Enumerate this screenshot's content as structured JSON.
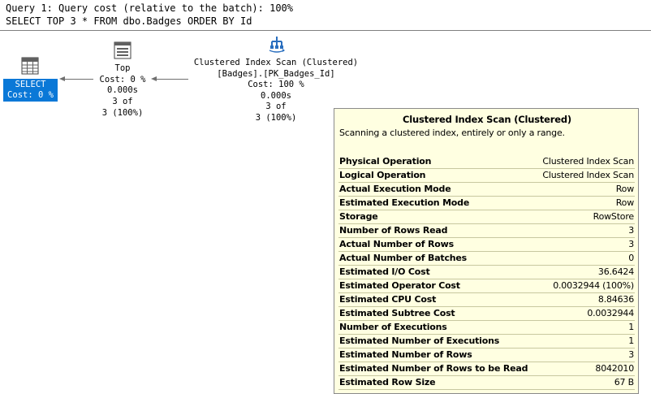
{
  "header": {
    "line1": "Query 1: Query cost (relative to the batch): 100%",
    "line2": "SELECT TOP 3 * FROM dbo.Badges ORDER BY Id"
  },
  "plan": {
    "select": {
      "name": "SELECT",
      "cost": "Cost: 0 %"
    },
    "top": {
      "name": "Top",
      "cost": "Cost: 0 %",
      "time": "0.000s",
      "rows": "3 of",
      "pct": "3 (100%)"
    },
    "scan": {
      "name": "Clustered Index Scan (Clustered)",
      "object": "[Badges].[PK_Badges_Id]",
      "cost": "Cost: 100 %",
      "time": "0.000s",
      "rows": "3 of",
      "pct": "3 (100%)"
    }
  },
  "tooltip": {
    "title": "Clustered Index Scan (Clustered)",
    "description": "Scanning a clustered index, entirely or only a range.",
    "properties": [
      {
        "key": "Physical Operation",
        "value": "Clustered Index Scan"
      },
      {
        "key": "Logical Operation",
        "value": "Clustered Index Scan"
      },
      {
        "key": "Actual Execution Mode",
        "value": "Row"
      },
      {
        "key": "Estimated Execution Mode",
        "value": "Row"
      },
      {
        "key": "Storage",
        "value": "RowStore"
      },
      {
        "key": "Number of Rows Read",
        "value": "3"
      },
      {
        "key": "Actual Number of Rows",
        "value": "3"
      },
      {
        "key": "Actual Number of Batches",
        "value": "0"
      },
      {
        "key": "Estimated I/O Cost",
        "value": "36.6424"
      },
      {
        "key": "Estimated Operator Cost",
        "value": "0.0032944 (100%)"
      },
      {
        "key": "Estimated CPU Cost",
        "value": "8.84636"
      },
      {
        "key": "Estimated Subtree Cost",
        "value": "0.0032944"
      },
      {
        "key": "Number of Executions",
        "value": "1"
      },
      {
        "key": "Estimated Number of Executions",
        "value": "1"
      },
      {
        "key": "Estimated Number of Rows",
        "value": "3"
      },
      {
        "key": "Estimated Number of Rows to be Read",
        "value": "8042010"
      },
      {
        "key": "Estimated Row Size",
        "value": "67 B"
      }
    ]
  },
  "colors": {
    "selection": "#0a78d7",
    "tooltip_bg": "#ffffe1"
  }
}
